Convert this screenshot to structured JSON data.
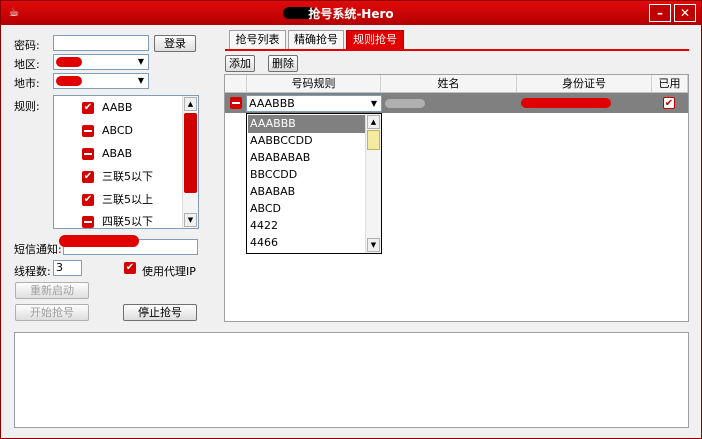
{
  "window": {
    "title": "抢号系统-Hero",
    "minimize_icon": "minimize-icon",
    "close_icon": "close-icon",
    "app_icon": "coffee-cup-icon"
  },
  "form": {
    "password_label": "密码:",
    "password_value": "",
    "login_button": "登录",
    "region_label": "地区:",
    "city_label": "地市:",
    "rules_label": "规则:",
    "sms_label": "短信通知:",
    "sms_value": "",
    "threads_label": "线程数:",
    "threads_value": "3",
    "proxy_label": "使用代理IP",
    "proxy_checked": true,
    "restart_button": "重新启动",
    "start_button": "开始抢号",
    "stop_button": "停止抢号"
  },
  "rules": [
    {
      "label": "AABB",
      "checked": true
    },
    {
      "label": "ABCD",
      "checked": false
    },
    {
      "label": "ABAB",
      "checked": false
    },
    {
      "label": "三联5以下",
      "checked": true
    },
    {
      "label": "三联5以上",
      "checked": true
    },
    {
      "label": "四联5以下",
      "checked": false
    }
  ],
  "tabs": [
    {
      "label": "抢号列表",
      "active": false
    },
    {
      "label": "精确抢号",
      "active": false
    },
    {
      "label": "规则抢号",
      "active": true
    }
  ],
  "toolbar": {
    "add_label": "添加",
    "delete_label": "删除"
  },
  "table": {
    "columns": [
      "号码规则",
      "姓名",
      "身份证号",
      "已用"
    ],
    "rows": [
      {
        "rule": "AAABBB",
        "name": "",
        "id": "",
        "used": true
      }
    ]
  },
  "dropdown": {
    "selected": "AAABBB",
    "options": [
      "AAABBB",
      "AABBCCDD",
      "ABABABAB",
      "BBCCDD",
      "ABABAB",
      "ABCD",
      "4422",
      "4466"
    ]
  },
  "colors": {
    "accent": "#e00000",
    "selected_row": "#808080"
  }
}
